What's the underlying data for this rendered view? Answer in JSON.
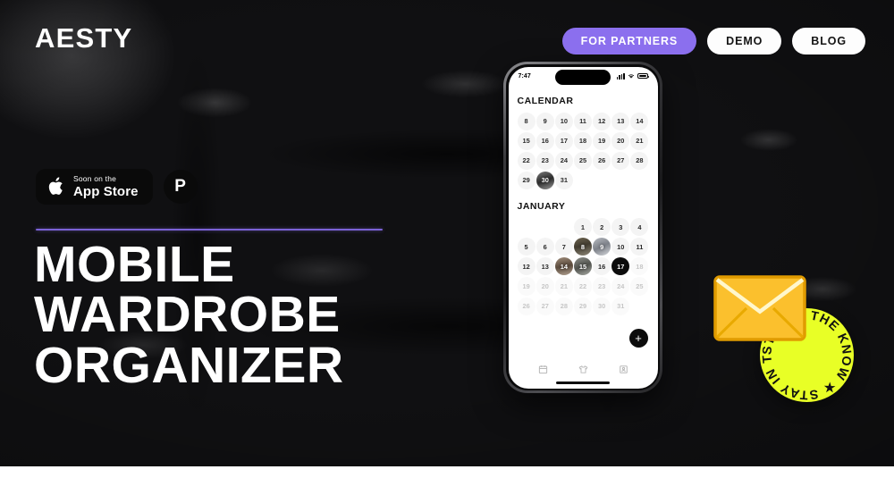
{
  "brand": {
    "logo": "AESTY"
  },
  "nav": {
    "items": [
      {
        "label": "FOR PARTNERS",
        "style": "accent"
      },
      {
        "label": "DEMO",
        "style": "light"
      },
      {
        "label": "BLOG",
        "style": "light"
      }
    ]
  },
  "stores": {
    "appstore": {
      "small": "Soon on the",
      "big": "App Store",
      "icon": "apple-icon"
    },
    "secondary": {
      "label": "P",
      "icon": "pinterest-icon"
    }
  },
  "hero": {
    "headline_lines": [
      "MOBILE",
      "WARDROBE",
      "ORGANIZER"
    ],
    "divider_color": "#7b62d6"
  },
  "phone": {
    "status": {
      "time": "7:47",
      "signal": "signal-icon",
      "wifi": "wifi-icon",
      "battery": "battery-icon"
    },
    "screens": [
      {
        "title": "CALENDAR",
        "lead_blanks": 0,
        "days": [
          {
            "n": "8"
          },
          {
            "n": "9"
          },
          {
            "n": "10"
          },
          {
            "n": "11"
          },
          {
            "n": "12"
          },
          {
            "n": "13"
          },
          {
            "n": "14"
          },
          {
            "n": "15"
          },
          {
            "n": "16"
          },
          {
            "n": "17"
          },
          {
            "n": "18"
          },
          {
            "n": "19"
          },
          {
            "n": "20"
          },
          {
            "n": "21"
          },
          {
            "n": "22"
          },
          {
            "n": "23"
          },
          {
            "n": "24"
          },
          {
            "n": "25"
          },
          {
            "n": "26"
          },
          {
            "n": "27"
          },
          {
            "n": "28"
          },
          {
            "n": "29"
          },
          {
            "n": "30",
            "photo": "p5"
          },
          {
            "n": "31"
          }
        ]
      },
      {
        "title": "JANUARY",
        "lead_blanks": 3,
        "days": [
          {
            "n": "1"
          },
          {
            "n": "2"
          },
          {
            "n": "3"
          },
          {
            "n": "4"
          },
          {
            "n": "5"
          },
          {
            "n": "6"
          },
          {
            "n": "7"
          },
          {
            "n": "8",
            "photo": "p1"
          },
          {
            "n": "9",
            "photo": "p2"
          },
          {
            "n": "10"
          },
          {
            "n": "11"
          },
          {
            "n": "12"
          },
          {
            "n": "13"
          },
          {
            "n": "14",
            "photo": "p3"
          },
          {
            "n": "15",
            "photo": "p4"
          },
          {
            "n": "16"
          },
          {
            "n": "17",
            "selected": true
          },
          {
            "n": "18",
            "muted": true
          },
          {
            "n": "19",
            "muted": true
          },
          {
            "n": "20",
            "muted": true
          },
          {
            "n": "21",
            "muted": true
          },
          {
            "n": "22",
            "muted": true
          },
          {
            "n": "23",
            "muted": true
          },
          {
            "n": "24",
            "muted": true
          },
          {
            "n": "25",
            "muted": true
          },
          {
            "n": "26",
            "muted": true
          },
          {
            "n": "27",
            "muted": true
          },
          {
            "n": "28",
            "muted": true
          },
          {
            "n": "29",
            "muted": true
          },
          {
            "n": "30",
            "muted": true
          },
          {
            "n": "31",
            "muted": true
          }
        ]
      }
    ],
    "fab": {
      "label": "+"
    },
    "tabs": [
      {
        "icon": "calendar-icon"
      },
      {
        "icon": "tshirt-icon"
      },
      {
        "icon": "profile-card-icon"
      }
    ]
  },
  "sticker": {
    "text": "STAY IN THE KNOW ★ ",
    "bg_color": "#e8ff26",
    "icon": "envelope-icon"
  }
}
